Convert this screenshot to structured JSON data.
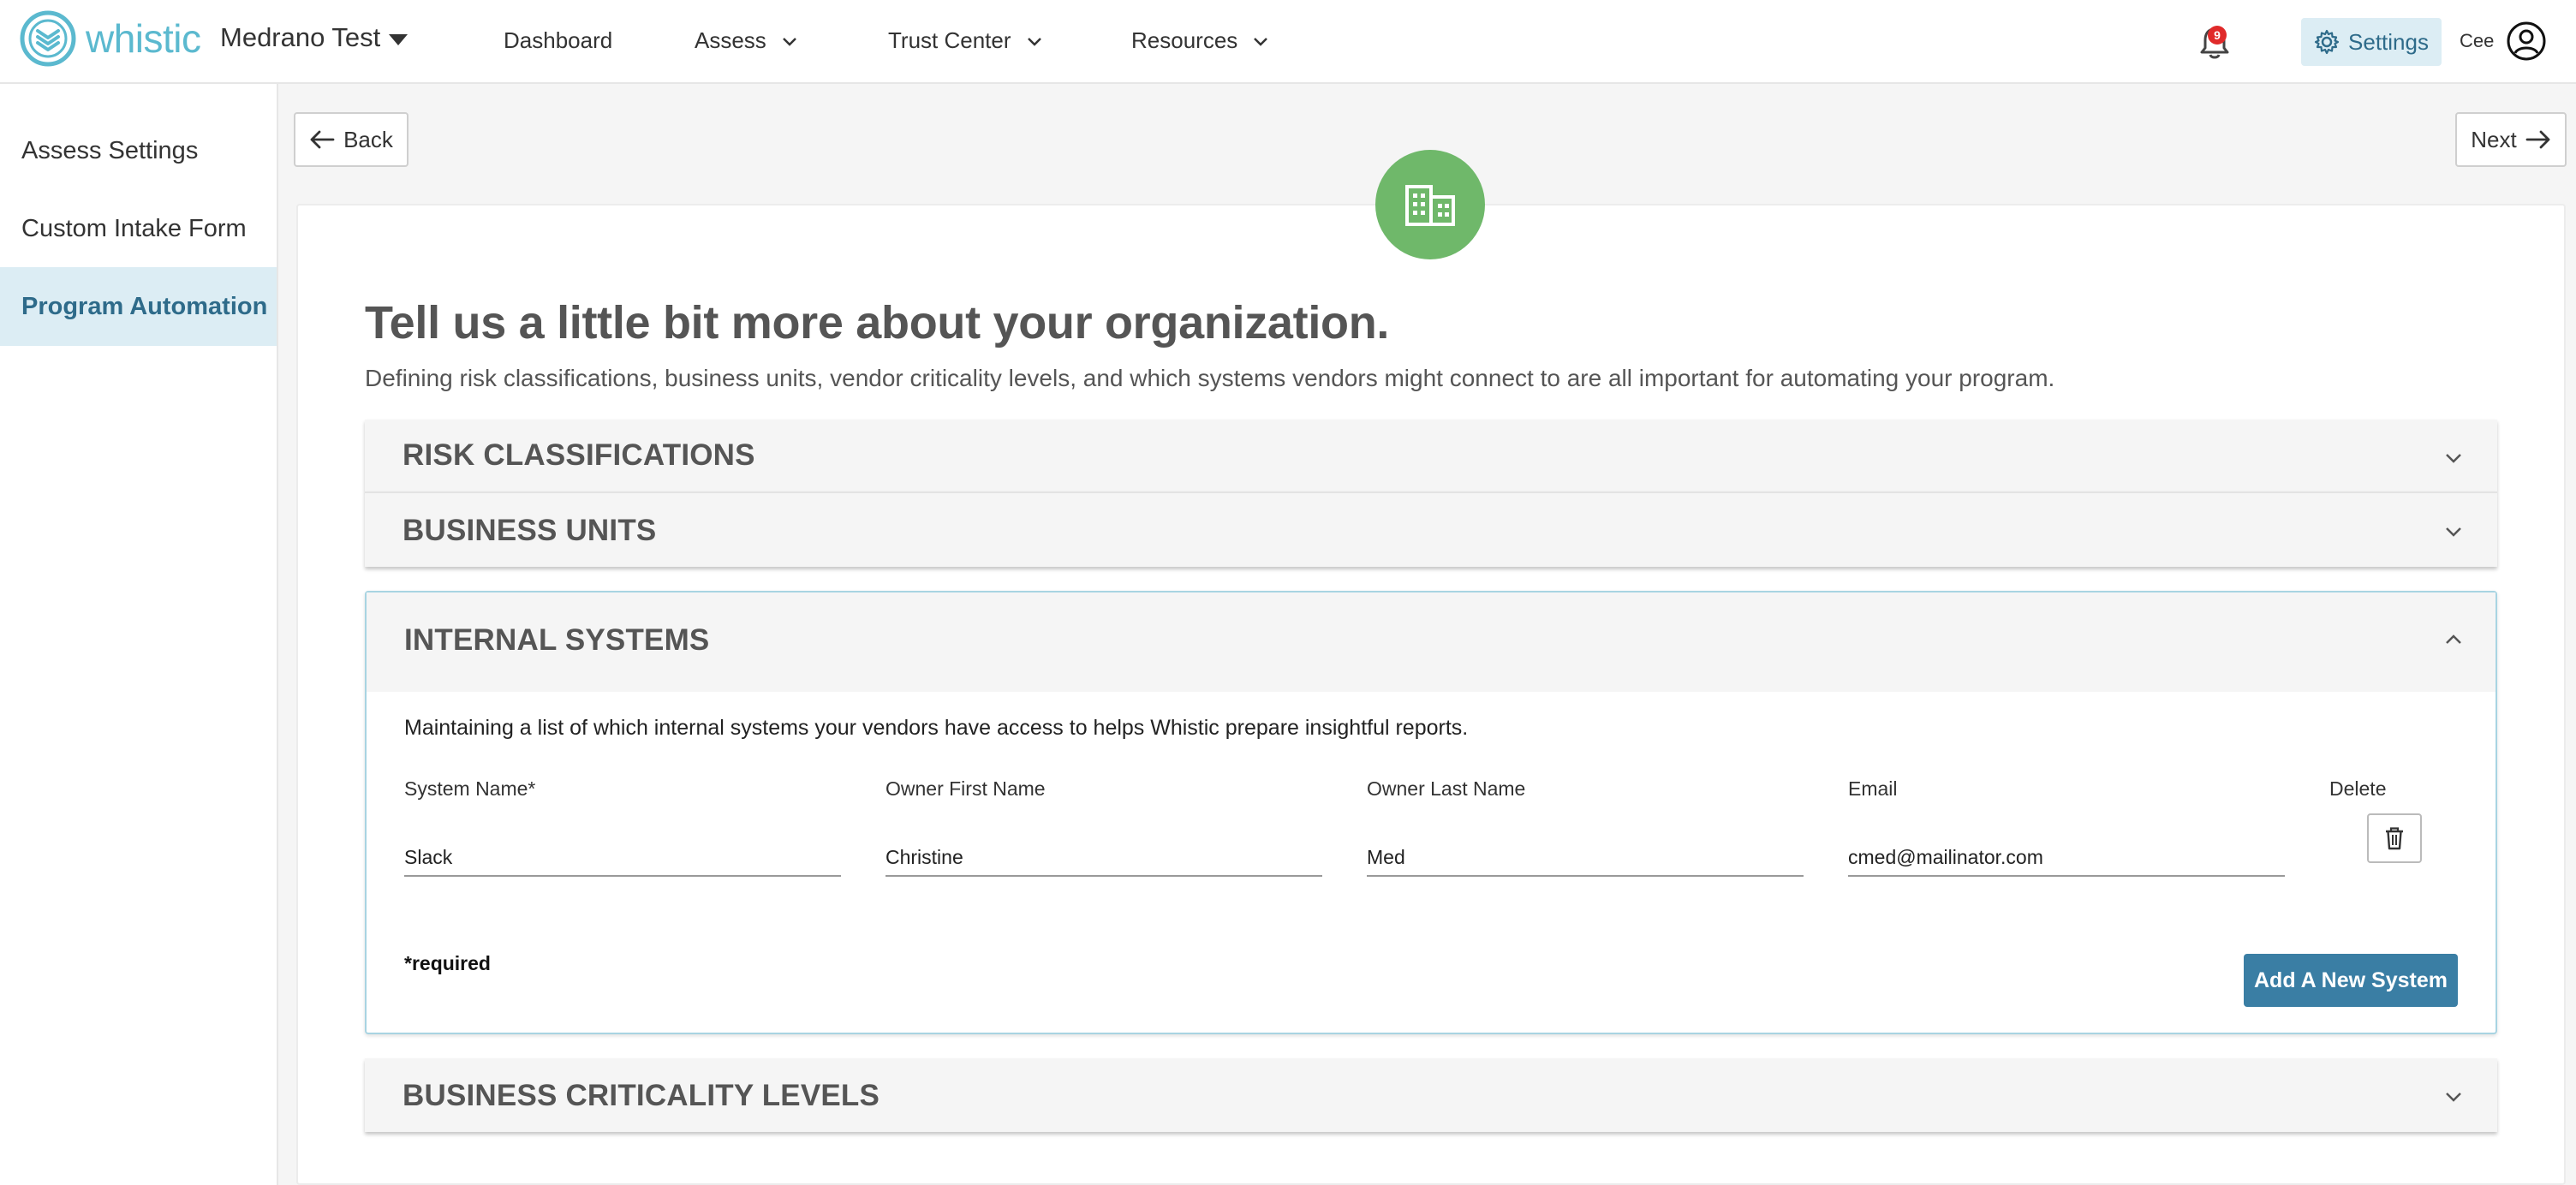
{
  "brand": {
    "logo_text": "whistic",
    "accent_color": "#5bb9cf"
  },
  "org": {
    "name": "Medrano Test"
  },
  "nav": {
    "dashboard": "Dashboard",
    "assess": "Assess",
    "trust_center": "Trust Center",
    "resources": "Resources"
  },
  "header": {
    "notification_count": "9",
    "settings_label": "Settings",
    "user_initials": "Cee"
  },
  "sidebar": {
    "items": [
      {
        "label": "Assess Settings"
      },
      {
        "label": "Custom Intake Form"
      },
      {
        "label": "Program Automation",
        "active": true
      }
    ]
  },
  "main": {
    "back_label": "Back",
    "next_label": "Next",
    "headline": "Tell us a little bit more about your organization.",
    "subhead": "Defining risk classifications, business units, vendor criticality levels, and which systems vendors might connect to are all important for automating your program."
  },
  "sections": {
    "risk": "RISK CLASSIFICATIONS",
    "business_units": "BUSINESS UNITS",
    "internal": {
      "title": "INTERNAL SYSTEMS",
      "description": "Maintaining a list of which internal systems your vendors have access to helps Whistic prepare insightful reports.",
      "columns": {
        "system_name": "System Name*",
        "owner_first": "Owner First Name",
        "owner_last": "Owner Last Name",
        "email": "Email",
        "delete": "Delete"
      },
      "row": {
        "system_name": "Slack",
        "owner_first": "Christine",
        "owner_last": "Med",
        "email": "cmed@mailinator.com"
      },
      "required_note": "*required",
      "add_button": "Add A New System"
    },
    "criticality": "BUSINESS CRITICALITY LEVELS"
  },
  "colors": {
    "active_bg": "#dcedf4",
    "active_text": "#2e6b8a",
    "primary_button": "#3a7ea4",
    "org_icon_bg": "#6fb86a",
    "badge": "#e02a2a"
  }
}
